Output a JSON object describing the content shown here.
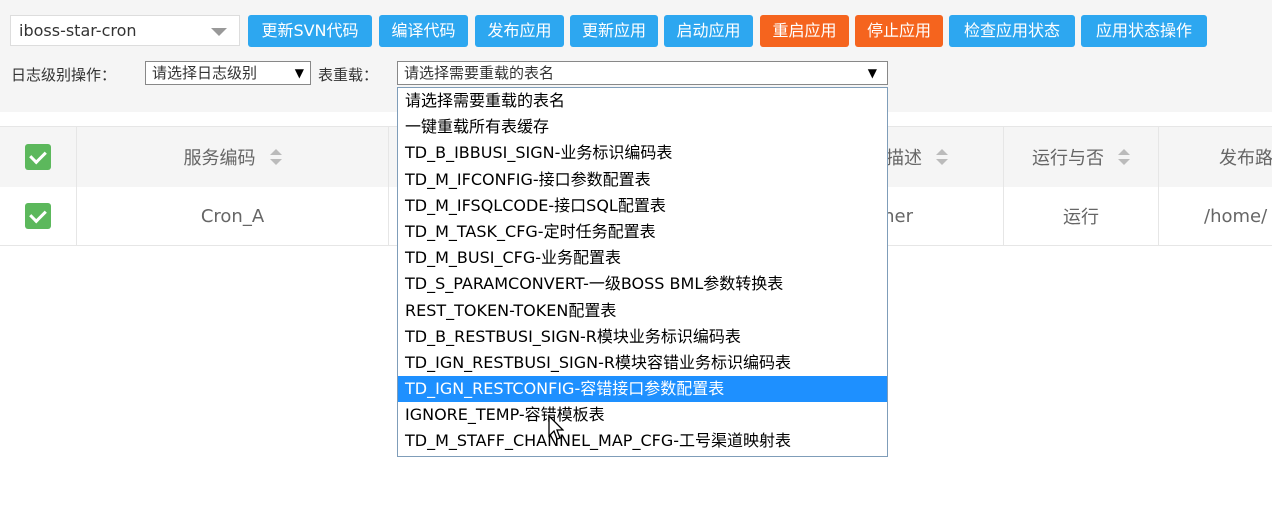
{
  "toolbar": {
    "app_select": "iboss-star-cron",
    "buttons": [
      "更新SVN代码",
      "编译代码",
      "发布应用",
      "更新应用",
      "启动应用",
      "重启应用",
      "停止应用",
      "检查应用状态",
      "应用状态操作"
    ],
    "log_level_label": "日志级别操作：",
    "log_level_select": "请选择日志级别",
    "reload_label": "表重载：",
    "reload_select": "请选择需要重载的表名",
    "arrow_glyph": "▼",
    "colors": {
      "primary": "#2da7f0",
      "danger": "#f5641e"
    }
  },
  "table": {
    "headers": {
      "service_code": "服务编码",
      "desc_partial": "描述",
      "running": "运行与否",
      "publish_partial": "发布路"
    },
    "row": {
      "service_code": "Cron_A",
      "desc_partial": "her",
      "running": "运行",
      "publish_partial": "/home/"
    }
  },
  "dropdown": {
    "options": [
      "请选择需要重载的表名",
      "一键重载所有表缓存",
      "TD_B_IBBUSI_SIGN-业务标识编码表",
      "TD_M_IFCONFIG-接口参数配置表",
      "TD_M_IFSQLCODE-接口SQL配置表",
      "TD_M_TASK_CFG-定时任务配置表",
      "TD_M_BUSI_CFG-业务配置表",
      "TD_S_PARAMCONVERT-一级BOSS BML参数转换表",
      "REST_TOKEN-TOKEN配置表",
      "TD_B_RESTBUSI_SIGN-R模块业务标识编码表",
      "TD_IGN_RESTBUSI_SIGN-R模块容错业务标识编码表",
      "TD_IGN_RESTCONFIG-容错接口参数配置表",
      "IGNORE_TEMP-容错模板表",
      "TD_M_STAFF_CHANNEL_MAP_CFG-工号渠道映射表"
    ],
    "highlighted_index": 11
  }
}
